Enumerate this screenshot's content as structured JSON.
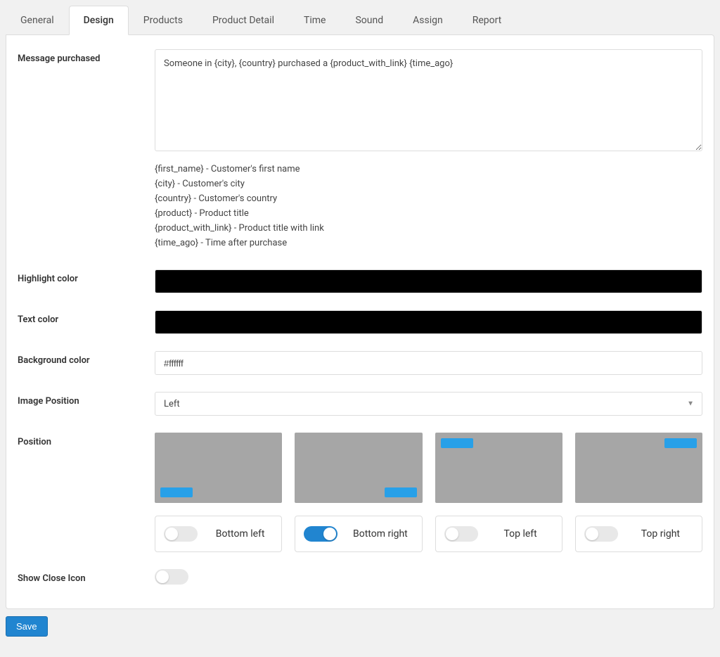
{
  "tabs": [
    "General",
    "Design",
    "Products",
    "Product Detail",
    "Time",
    "Sound",
    "Assign",
    "Report"
  ],
  "active_tab_index": 1,
  "labels": {
    "message_purchased": "Message purchased",
    "highlight_color": "Highlight color",
    "text_color": "Text color",
    "background_color": "Background color",
    "image_position": "Image Position",
    "position": "Position",
    "show_close_icon": "Show Close Icon"
  },
  "message_purchased_value": "Someone in {city}, {country} purchased a {product_with_link} {time_ago}",
  "help": [
    "{first_name} - Customer's first name",
    "{city} - Customer's city",
    "{country} - Customer's country",
    "{product} - Product title",
    "{product_with_link} - Product title with link",
    "{time_ago} - Time after purchase"
  ],
  "highlight_color": "#000000",
  "text_color": "#000000",
  "background_color": "#ffffff",
  "image_position_value": "Left",
  "positions": [
    {
      "label": "Bottom left",
      "marker": "bl",
      "active": false
    },
    {
      "label": "Bottom right",
      "marker": "br",
      "active": true
    },
    {
      "label": "Top left",
      "marker": "tl",
      "active": false
    },
    {
      "label": "Top right",
      "marker": "tr",
      "active": false
    }
  ],
  "show_close_icon": false,
  "save_button": "Save"
}
